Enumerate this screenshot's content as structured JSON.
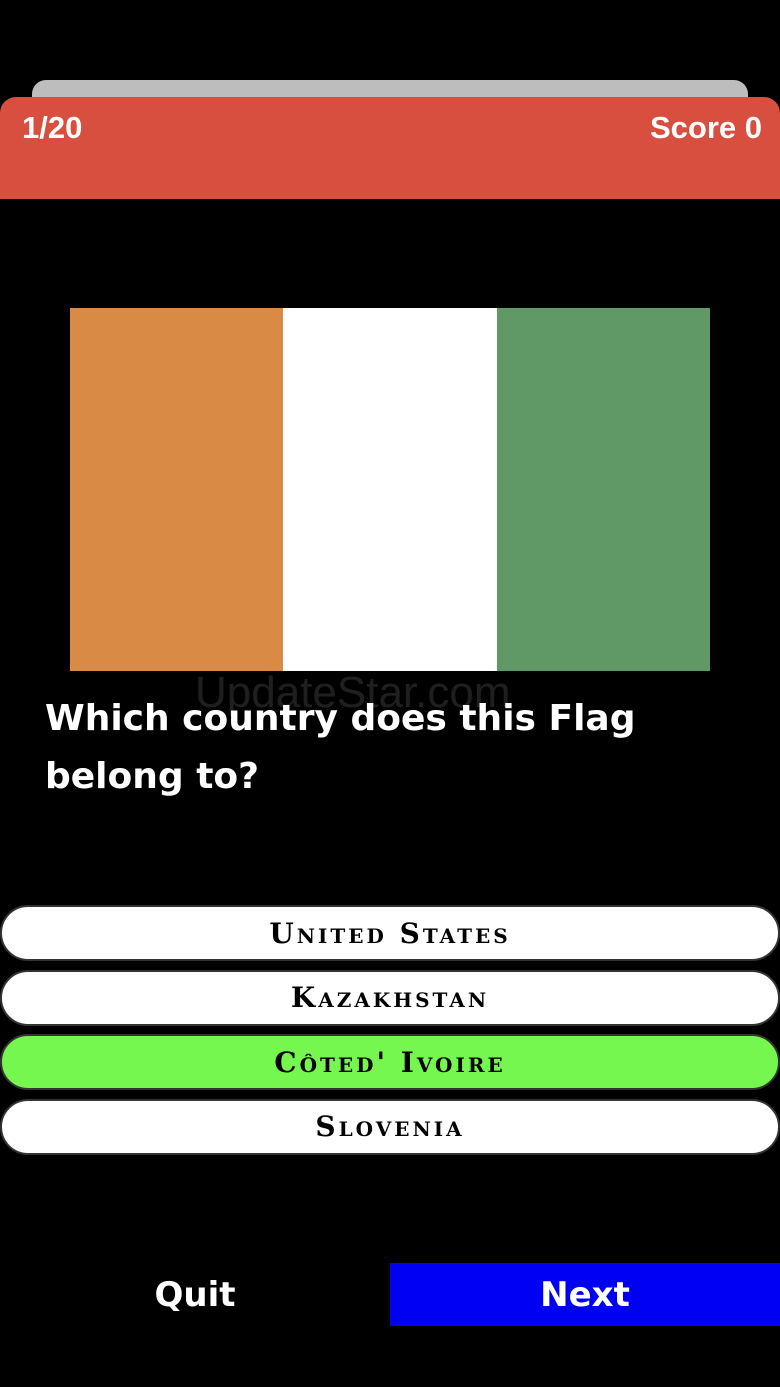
{
  "header": {
    "progress": "1/20",
    "score": "Score 0",
    "color": "#d84f3f"
  },
  "flag": {
    "stripes": [
      "#d98a44",
      "#ffffff",
      "#609866"
    ]
  },
  "watermark": "UpdateStar.com",
  "question": "Which country does this Flag belong to?",
  "answers": [
    {
      "label": "United States",
      "state": "default"
    },
    {
      "label": "Kazakhstan",
      "state": "default"
    },
    {
      "label": "Côted' Ivoire",
      "state": "correct"
    },
    {
      "label": "Slovenia",
      "state": "default"
    }
  ],
  "footer": {
    "quit_label": "Quit",
    "next_label": "Next",
    "next_color": "#0000f3"
  }
}
